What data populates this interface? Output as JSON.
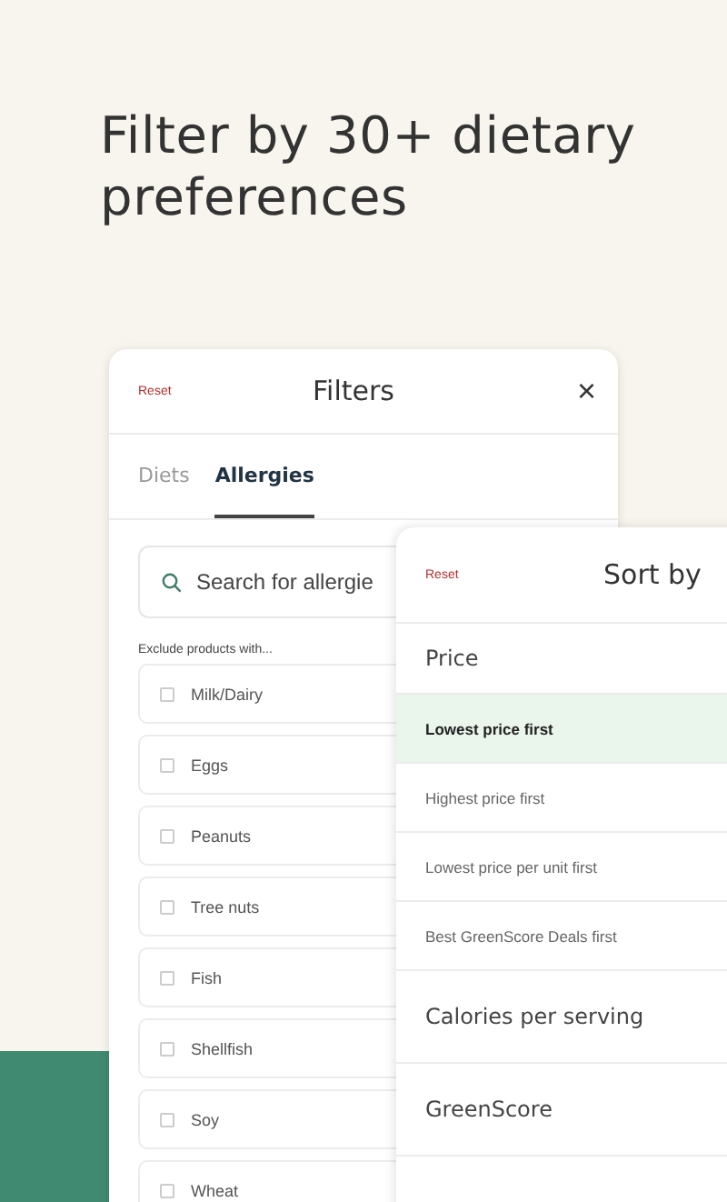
{
  "headline": "Filter by 30+ dietary preferences",
  "filters": {
    "reset": "Reset",
    "title": "Filters",
    "close": "×",
    "tabs": [
      {
        "label": "Diets",
        "selected": false
      },
      {
        "label": "Allergies",
        "selected": true
      }
    ],
    "search": {
      "placeholder": "Search for allergie"
    },
    "section_label": "Exclude products with...",
    "items": [
      {
        "label": "Milk/Dairy",
        "checked": false
      },
      {
        "label": "Eggs",
        "checked": false
      },
      {
        "label": "Peanuts",
        "checked": false
      },
      {
        "label": "Tree nuts",
        "checked": false
      },
      {
        "label": "Fish",
        "checked": false
      },
      {
        "label": "Shellfish",
        "checked": false
      },
      {
        "label": "Soy",
        "checked": false
      },
      {
        "label": "Wheat",
        "checked": false
      }
    ]
  },
  "sort": {
    "reset": "Reset",
    "title": "Sort by",
    "groups": [
      {
        "label": "Price",
        "options": [
          {
            "label": "Lowest price first",
            "selected": true
          },
          {
            "label": "Highest price first",
            "selected": false
          },
          {
            "label": "Lowest price per unit first",
            "selected": false
          },
          {
            "label": "Best GreenScore Deals first",
            "selected": false
          }
        ]
      },
      {
        "label": "Calories per serving"
      },
      {
        "label": "GreenScore"
      }
    ]
  }
}
